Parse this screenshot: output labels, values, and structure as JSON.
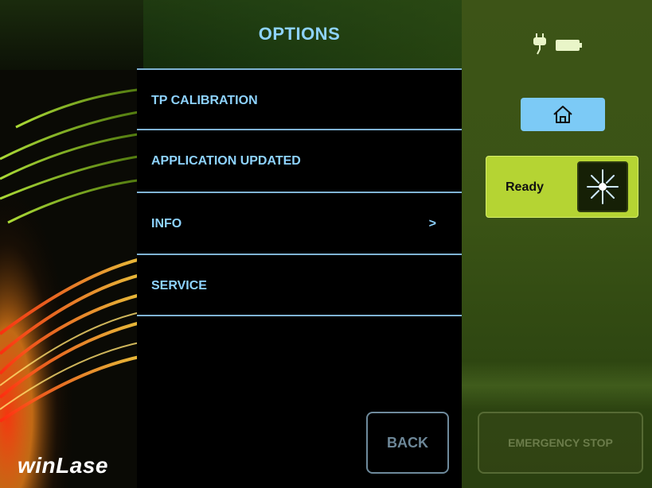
{
  "header": {
    "title": "OPTIONS"
  },
  "menu": {
    "items": [
      {
        "label": "TP CALIBRATION",
        "chevron": ""
      },
      {
        "label": "APPLICATION UPDATED",
        "chevron": ""
      },
      {
        "label": "INFO",
        "chevron": ">"
      },
      {
        "label": "SERVICE",
        "chevron": ""
      }
    ]
  },
  "back_button": {
    "label": "BACK"
  },
  "brand": {
    "name": "winLase"
  },
  "status": {
    "power_icon": "plug-icon",
    "battery_icon": "battery-icon",
    "home_icon": "home-icon",
    "ready_label": "Ready",
    "laser_icon": "laser-burst-icon"
  },
  "emergency_button": {
    "label": "EMERGENCY STOP"
  },
  "colors": {
    "accent_blue": "#8ed3ff",
    "ready_green": "#b5d433",
    "home_button_blue": "#7ccaf6",
    "menu_divider": "#7fb3d4"
  }
}
